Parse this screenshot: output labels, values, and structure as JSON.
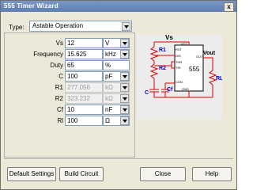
{
  "window": {
    "title": "555 Timer Wizard",
    "close_label": "x"
  },
  "type": {
    "label": "Type:",
    "selected": "Astable Operation"
  },
  "params": [
    {
      "label": "Vs",
      "value": "12",
      "unit": "V"
    },
    {
      "label": "Frequency",
      "value": "15.625",
      "unit": "kHz"
    },
    {
      "label": "Duty",
      "value": "65",
      "unit": "%"
    },
    {
      "label": "C",
      "value": "100",
      "unit": "pF"
    },
    {
      "label": "R1",
      "value": "277.056",
      "unit": "kΩ"
    },
    {
      "label": "R2",
      "value": "323.232",
      "unit": "kΩ"
    },
    {
      "label": "Cf",
      "value": "10",
      "unit": "nF"
    },
    {
      "label": "Rl",
      "value": "100",
      "unit": "Ω"
    }
  ],
  "schematic": {
    "vs": "Vs",
    "r1": "R1",
    "r2": "R2",
    "c": "C",
    "cf": "Cf",
    "vout": "Vout",
    "rl": "RL",
    "chip": "555",
    "pins": {
      "rst": "RST",
      "dis": "DIS",
      "thr": "THR",
      "trg": "TRI",
      "con": "CON",
      "vcc": "VCC",
      "out": "OUT",
      "gnd": "GND"
    }
  },
  "buttons": {
    "default": "Default Settings",
    "build": "Build Circuit",
    "close": "Close",
    "help": "Help"
  }
}
